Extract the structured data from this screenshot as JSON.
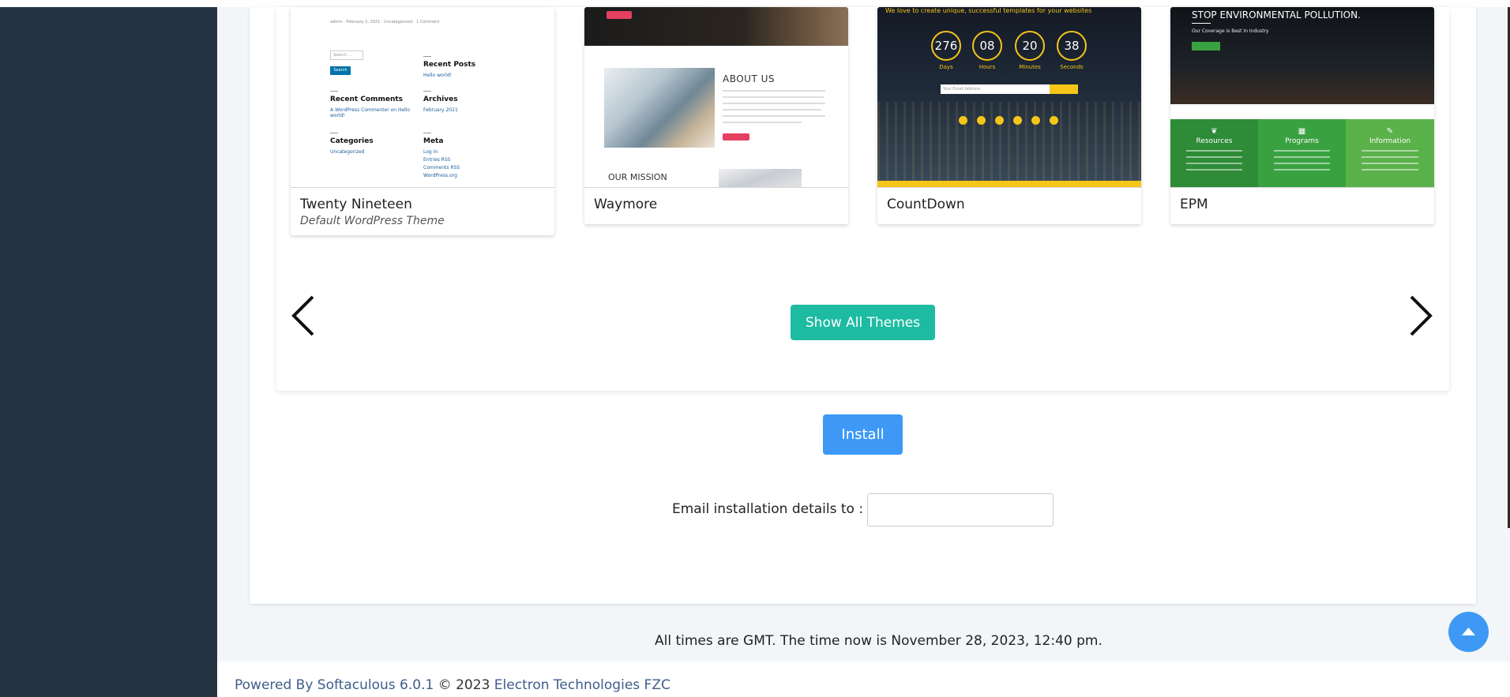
{
  "themes": [
    {
      "name": "Twenty Nineteen",
      "subtitle": "Default WordPress Theme"
    },
    {
      "name": "Waymore",
      "subtitle": ""
    },
    {
      "name": "CountDown",
      "subtitle": ""
    },
    {
      "name": "EPM",
      "subtitle": ""
    }
  ],
  "thumb_twenty_nineteen": {
    "meta": "admin · February 2, 2021 · Uncategorized · 1 Comment",
    "search_placeholder": "Search ...",
    "search_button": "Search",
    "recent_posts": "Recent Posts",
    "recent_posts_link": "Hello world!",
    "recent_comments": "Recent Comments",
    "recent_comments_link": "A WordPress Commenter on Hello world!",
    "archives": "Archives",
    "archives_link": "February 2021",
    "categories": "Categories",
    "categories_link": "Uncategorized",
    "meta_heading": "Meta",
    "meta_links": [
      "Log in",
      "Entries RSS",
      "Comments RSS",
      "WordPress.org"
    ]
  },
  "thumb_waymore": {
    "about": "ABOUT US",
    "mission": "OUR MISSION"
  },
  "thumb_countdown": {
    "tagline": "We love to create unique, successful templates for your websites",
    "counters": [
      {
        "value": "276",
        "unit": "Days"
      },
      {
        "value": "08",
        "unit": "Hours"
      },
      {
        "value": "20",
        "unit": "Minutes"
      },
      {
        "value": "38",
        "unit": "Seconds"
      }
    ],
    "email_placeholder": "Your Email Address"
  },
  "thumb_epm": {
    "hero_title": "STOP ENVIRONMENTAL POLLUTION.",
    "hero_sub": "Our Coverage is Best In Industry",
    "columns": [
      "Resources",
      "Programs",
      "Information"
    ]
  },
  "colors": {
    "sidebar": "#253442",
    "show_all": "#1dbca2",
    "install": "#3d99f5",
    "countdown_accent": "#f5c518",
    "epm_greens": [
      "#2e8b37",
      "#3aa140",
      "#5bb14a"
    ]
  },
  "carousel": {
    "prev_icon": "chevron-left-icon",
    "next_icon": "chevron-right-icon",
    "show_all_label": "Show All Themes"
  },
  "install_label": "Install",
  "email_label": "Email installation details to :",
  "time_text": "All times are GMT. The time now is November 28, 2023, 12:40 pm.",
  "footer": {
    "powered": "Powered By Softaculous 6.0.1",
    "copyright": " © 2023 ",
    "company": "Electron Technologies FZC"
  },
  "scroll_top_icon": "caret-up-icon"
}
